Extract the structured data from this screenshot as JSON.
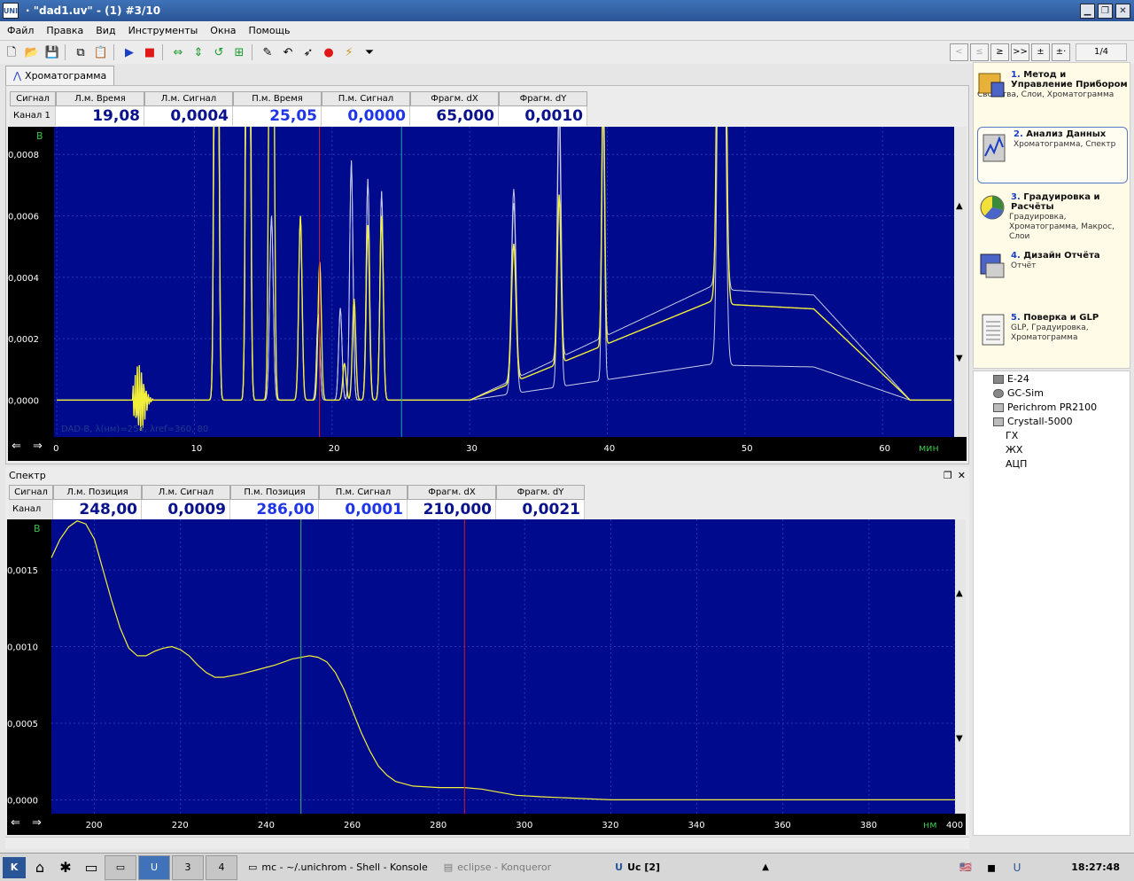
{
  "window": {
    "title": "· \"dad1.uv\" - (1) #3/10",
    "app_icon": "UNI"
  },
  "menu": [
    "Файл",
    "Правка",
    "Вид",
    "Инструменты",
    "Окна",
    "Помощь"
  ],
  "pager": {
    "buttons": [
      "<",
      "≤",
      "≥",
      ">>",
      "±",
      "±·"
    ],
    "count": "1/4"
  },
  "tab": {
    "label": "Хроматограмма"
  },
  "chrom": {
    "headers": [
      "Сигнал",
      "Л.м. Время",
      "Л.м. Сигнал",
      "П.м. Время",
      "П.м. Сигнал",
      "Фрагм. dX",
      "Фрагм. dY"
    ],
    "row_label": "Канал 1",
    "values": [
      "19,08",
      "0,0004",
      "25,05",
      "0,0000",
      "65,000",
      "0,0010"
    ],
    "y_unit": "В",
    "x_unit": "мин",
    "y_ticks": [
      "0,0008",
      "0,0006",
      "0,0004",
      "0,0002",
      "0,0000"
    ],
    "x_ticks": [
      "0",
      "10",
      "20",
      "30",
      "40",
      "50",
      "60"
    ],
    "overlay_text": "DAD-B, λ(нм)=254, λref=360, 80"
  },
  "spectrum": {
    "title": "Спектр",
    "headers": [
      "Сигнал",
      "Л.м. Позиция",
      "Л.м. Сигнал",
      "П.м. Позиция",
      "П.м. Сигнал",
      "Фрагм. dX",
      "Фрагм. dY"
    ],
    "row_label": "Канал 1",
    "values": [
      "248,00",
      "0,0009",
      "286,00",
      "0,0001",
      "210,000",
      "0,0021"
    ],
    "y_unit": "В",
    "x_unit": "нм",
    "y_ticks": [
      "0,0015",
      "0,0010",
      "0,0005",
      "0,0000"
    ],
    "x_ticks": [
      "200",
      "220",
      "240",
      "260",
      "280",
      "300",
      "320",
      "340",
      "360",
      "380",
      "400"
    ]
  },
  "panel": [
    {
      "num": "1.",
      "title": "Метод и Управление Прибором",
      "sub": "Свойства, Слои, Хроматограмма"
    },
    {
      "num": "2.",
      "title": "Анализ Данных",
      "sub": "Хроматограмма, Спектр"
    },
    {
      "num": "3.",
      "title": "Градуировка и Расчёты",
      "sub": "Градуировка, Хроматограмма, Макрос, Слои"
    },
    {
      "num": "4.",
      "title": "Дизайн Отчёта",
      "sub": "Отчёт"
    },
    {
      "num": "5.",
      "title": "Поверка и GLP",
      "sub": "GLP, Градуировка, Хроматограмма"
    }
  ],
  "tree": [
    "E-24",
    "GC-Sim",
    "Perichrom PR2100",
    "Crystall-5000",
    "ГХ",
    "ЖХ",
    "АЦП"
  ],
  "taskbar": {
    "desktops": [
      "3",
      "4"
    ],
    "tasks": [
      "mc - ~/.unichrom - Shell - Konsole",
      "eclipse - Konqueror",
      "Uc [2]"
    ],
    "clock": "18:27:48"
  },
  "colors": {
    "plot_bg": "#000a8c",
    "trace_yellow": "#f2ef3a",
    "trace_white": "#c9cce6",
    "cursor_red": "#e01818",
    "cursor_green": "#3ac24a",
    "cursor_teal": "#14a8a0"
  }
}
